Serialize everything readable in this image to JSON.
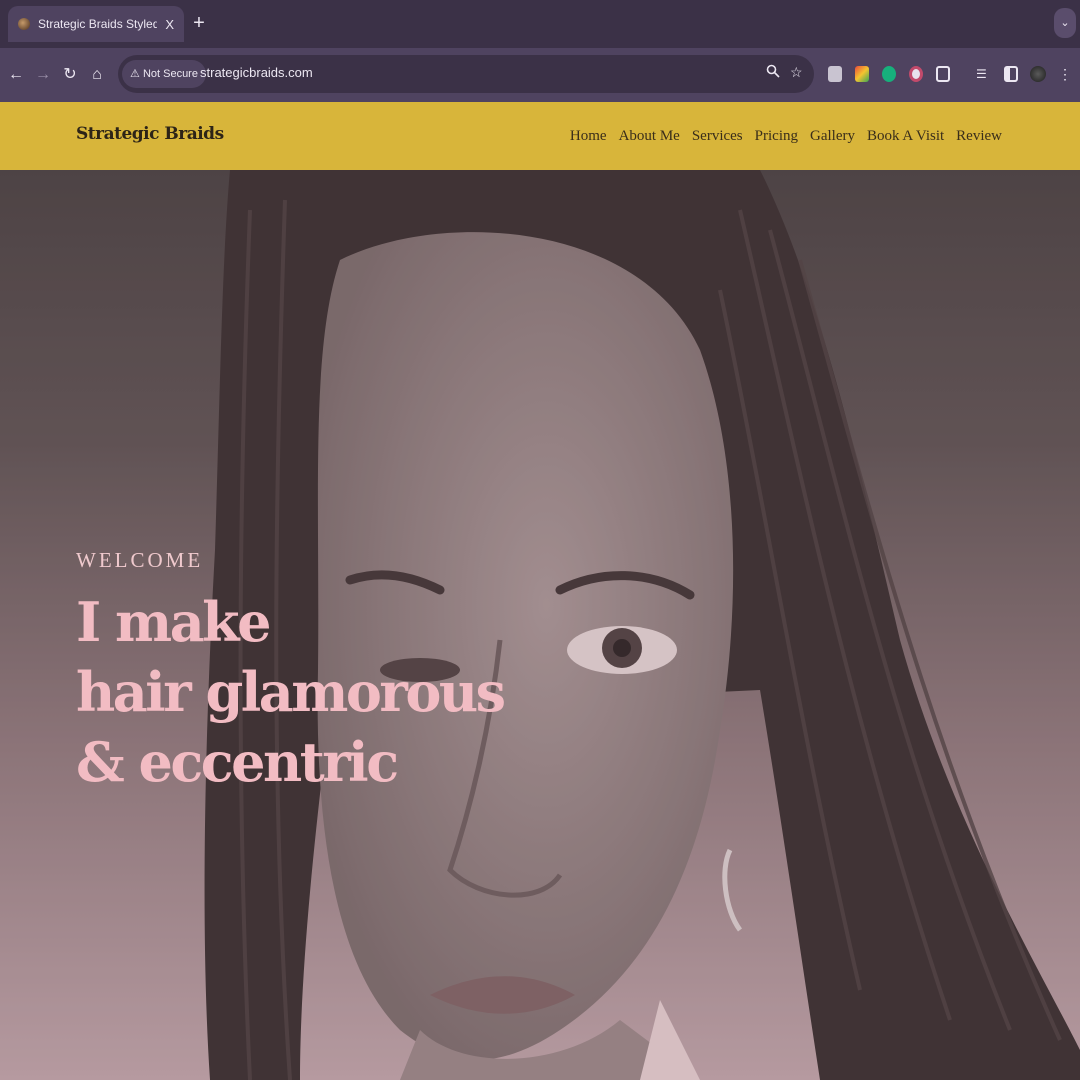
{
  "browser": {
    "tab": {
      "title": "Strategic Braids Styled By Be",
      "close": "X"
    },
    "new_tab": "+",
    "tab_list": "⌄",
    "nav": {
      "back": "←",
      "forward": "→",
      "reload": "↻",
      "home": "⌂"
    },
    "security_label": "Not Secure",
    "url": "strategicbraids.com"
  },
  "site": {
    "brand": "Strategic Braids",
    "nav": [
      "Home",
      "About Me",
      "Services",
      "Pricing",
      "Gallery",
      "Book A Visit",
      "Review"
    ],
    "hero": {
      "eyebrow": "WELCOME",
      "headline": [
        "I make",
        "hair glamorous",
        "& eccentric"
      ]
    }
  },
  "colors": {
    "header_bg": "#d8b53a",
    "browser_chrome": "#3b3147",
    "headline": "#f2bcc3"
  }
}
